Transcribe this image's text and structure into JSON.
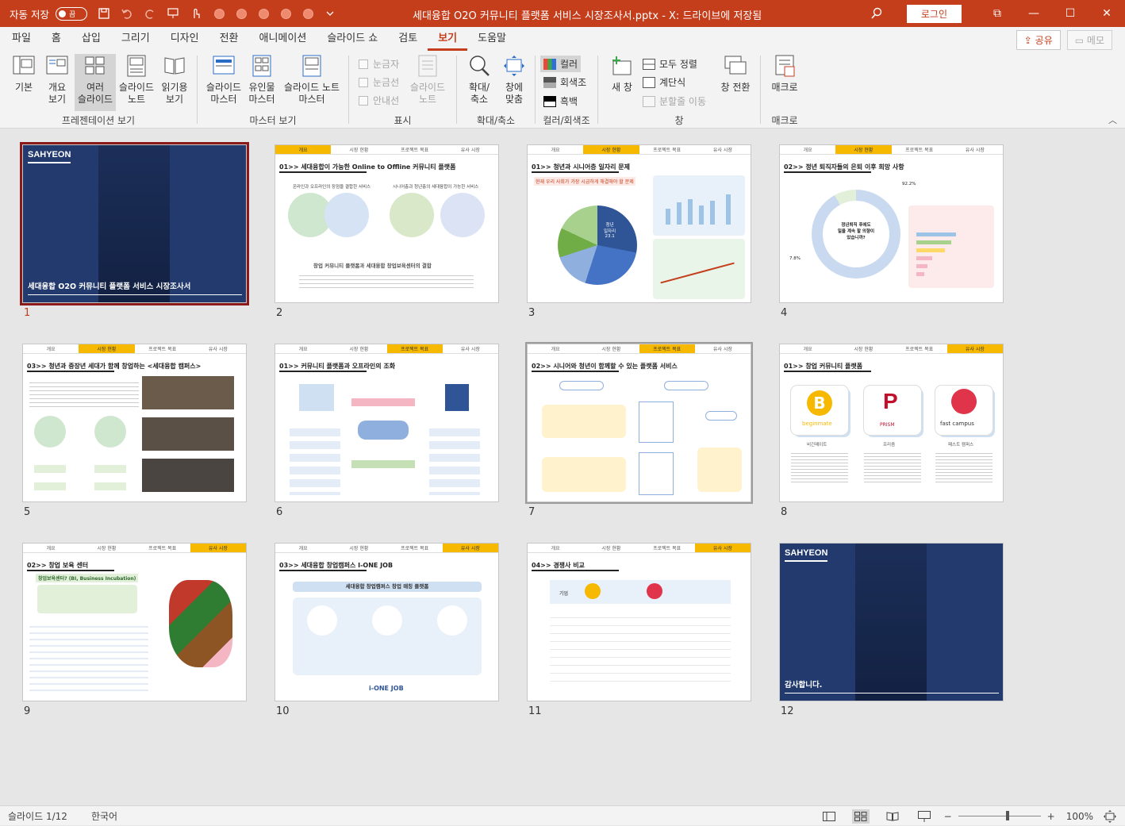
{
  "titlebar": {
    "autosave_label": "자동 저장",
    "autosave_state": "끔",
    "doc_title": "세대융합 O2O 커뮤니티 플랫폼 서비스 시장조사서.pptx - X: 드라이브에 저장됨",
    "login_label": "로그인",
    "accent": "#c43e1c"
  },
  "tabs": [
    "파일",
    "홈",
    "삽입",
    "그리기",
    "디자인",
    "전환",
    "애니메이션",
    "슬라이드 쇼",
    "검토",
    "보기",
    "도움말"
  ],
  "active_tab": "보기",
  "tab_actions": {
    "share": "공유",
    "memo": "메모"
  },
  "ribbon": {
    "presentation_view": {
      "label": "프레젠테이션 보기",
      "buttons": [
        "기본",
        "개요\n보기",
        "여러\n슬라이드",
        "슬라이드\n노트",
        "읽기용\n보기"
      ]
    },
    "master_view": {
      "label": "마스터 보기",
      "buttons": [
        "슬라이드\n마스터",
        "유인물\n마스터",
        "슬라이드 노트\n마스터"
      ]
    },
    "show": {
      "label": "표시",
      "checks": [
        "눈금자",
        "눈금선",
        "안내선"
      ],
      "notes": "슬라이드\n노트"
    },
    "zoom": {
      "label": "확대/축소",
      "buttons": [
        "확대/\n축소",
        "창에\n맞춤"
      ]
    },
    "color": {
      "label": "컬러/회색조",
      "options": [
        "컬러",
        "회색조",
        "흑백"
      ]
    },
    "window": {
      "label": "창",
      "new_window": "새 창",
      "options": [
        "모두 정렬",
        "계단식",
        "분할줄 이동"
      ],
      "switch": "창 전환"
    },
    "macro": {
      "label": "매크로",
      "button": "매크로"
    }
  },
  "slides": [
    {
      "num": "1",
      "type": "cover",
      "brand": "SAHYEON",
      "caption": "세대융합 O2O 커뮤니티 플랫폼 서비스 시장조사서"
    },
    {
      "num": "2",
      "type": "content",
      "tabs": [
        "개요",
        "시장 현황",
        "프로젝트 목표",
        "유사 시장"
      ],
      "active": 0,
      "title": "01>> 세대융합이 가능한 Online to Offline 커뮤니티 플랫폼"
    },
    {
      "num": "3",
      "type": "content",
      "tabs": [
        "개요",
        "시장 현황",
        "프로젝트 목표",
        "유사 시장"
      ],
      "active": 1,
      "title": "01>> 청년과 시니어층 일자리 문제"
    },
    {
      "num": "4",
      "type": "content",
      "tabs": [
        "개요",
        "시장 현황",
        "프로젝트 목표",
        "유사 시장"
      ],
      "active": 1,
      "title": "02>> 정년 퇴직자들의 은퇴 이후 희망 사항"
    },
    {
      "num": "5",
      "type": "content",
      "tabs": [
        "개요",
        "시장 현황",
        "프로젝트 목표",
        "유사 시장"
      ],
      "active": 1,
      "title": "03>> 청년과 중장년 세대가 함께 창업하는 <세대융합 캠퍼스>"
    },
    {
      "num": "6",
      "type": "content",
      "tabs": [
        "개요",
        "시장 현황",
        "프로젝트 목표",
        "유사 시장"
      ],
      "active": 2,
      "title": "01>> 커뮤니티 플랫폼과 오프라인의 조화"
    },
    {
      "num": "7",
      "type": "content",
      "tabs": [
        "개요",
        "시장 현황",
        "프로젝트 목표",
        "유사 시장"
      ],
      "active": 2,
      "title": "02>> 시니어와 청년이 함께할 수 있는 플랫폼 서비스"
    },
    {
      "num": "8",
      "type": "content",
      "tabs": [
        "개요",
        "시장 현황",
        "프로젝트 목표",
        "유사 시장"
      ],
      "active": 3,
      "title": "01>> 창업 커뮤니티 플랫폼"
    },
    {
      "num": "9",
      "type": "content",
      "tabs": [
        "개요",
        "시장 현황",
        "프로젝트 목표",
        "유사 시장"
      ],
      "active": 3,
      "title": "02>> 창업 보육 센터"
    },
    {
      "num": "10",
      "type": "content",
      "tabs": [
        "개요",
        "시장 현황",
        "프로젝트 목표",
        "유사 시장"
      ],
      "active": 3,
      "title": "03>> 세대융합 창업캠퍼스 I-ONE JOB"
    },
    {
      "num": "11",
      "type": "content",
      "tabs": [
        "개요",
        "시장 현황",
        "프로젝트 목표",
        "유사 시장"
      ],
      "active": 3,
      "title": "04>> 경쟁사 비교"
    },
    {
      "num": "12",
      "type": "cover",
      "brand": "SAHYEON",
      "caption": "감사합니다."
    }
  ],
  "slide_details": {
    "s2": {
      "left": "온라인과 오프라인의 장점을 결합한 서비스",
      "right": "시니어층과 청년층의 세대융합이 가능한 서비스",
      "bottom": "창업 커뮤니티 플랫폼과 세대융합 창업보육센터의 결합"
    },
    "s3": {
      "subtitle": "현재 우리 사회가 가장 시급하게 해결해야 할 문제",
      "pie_big": "청년\n일자리\n23.1",
      "pie_mid": "저출산과\n인구고령화\n22.7",
      "pie_small": "빈부격차\n20.0"
    },
    "s4": {
      "center": "정년퇴직 후에도\n일을 계속 할 의향이\n있습니까?",
      "pct_a": "92.2%",
      "pct_b": "7.8%"
    },
    "s8": {
      "logos": [
        "beginmate",
        "PRISM",
        "fast campus"
      ],
      "names": [
        "비긴메이트",
        "프리즘",
        "패스트 캠퍼스"
      ]
    },
    "s9": {
      "box": "창업보육센터? (BI, Business Incubation)"
    },
    "s10": {
      "banner": "세대융합 창업캠퍼스 창업 매칭 플랫폼",
      "brand": "i-ONE JOB"
    },
    "s11": {
      "header": "기업"
    }
  },
  "status": {
    "slide_info": "슬라이드 1/12",
    "language": "한국어",
    "zoom": "100%"
  }
}
